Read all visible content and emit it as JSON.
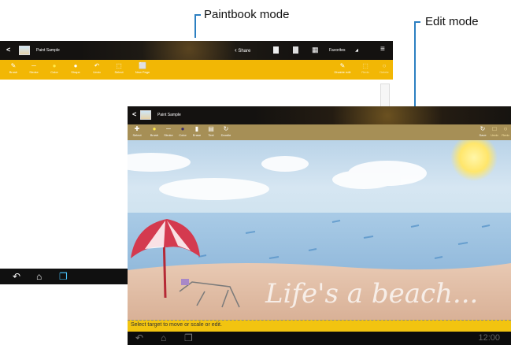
{
  "callouts": {
    "paintbook": "Paintbook mode",
    "edit": "Edit mode"
  },
  "paintbook": {
    "title": "Paint Sample",
    "share_label": "Share",
    "favorites_label": "Favorites",
    "tools": [
      "Brush",
      "Stroke",
      "Color",
      "Shape",
      "Undo",
      "Select",
      "New Page"
    ],
    "right_tools": [
      "Disable edit",
      "Redo",
      "Delete"
    ]
  },
  "edit": {
    "title": "Paint Sample",
    "tools": [
      "Select",
      "Brush",
      "Stroke",
      "Color",
      "Erase",
      "Text",
      "Doodle"
    ],
    "right_tools": [
      "Save",
      "Undo",
      "Redo"
    ],
    "status_text": "Select target to move or scale or edit.",
    "clock": "12:00",
    "canvas_text": "Life's a beach..."
  },
  "colors": {
    "toolbar_yellow": "#f2b705",
    "toolbar_khaki": "#a68f56",
    "callout_line": "#2c7fc1",
    "status_yellow": "#f2c410"
  },
  "icons": [
    "back-icon",
    "share-icon",
    "book-icon",
    "grid-icon",
    "menu-icon",
    "home-icon",
    "recent-apps-icon"
  ]
}
